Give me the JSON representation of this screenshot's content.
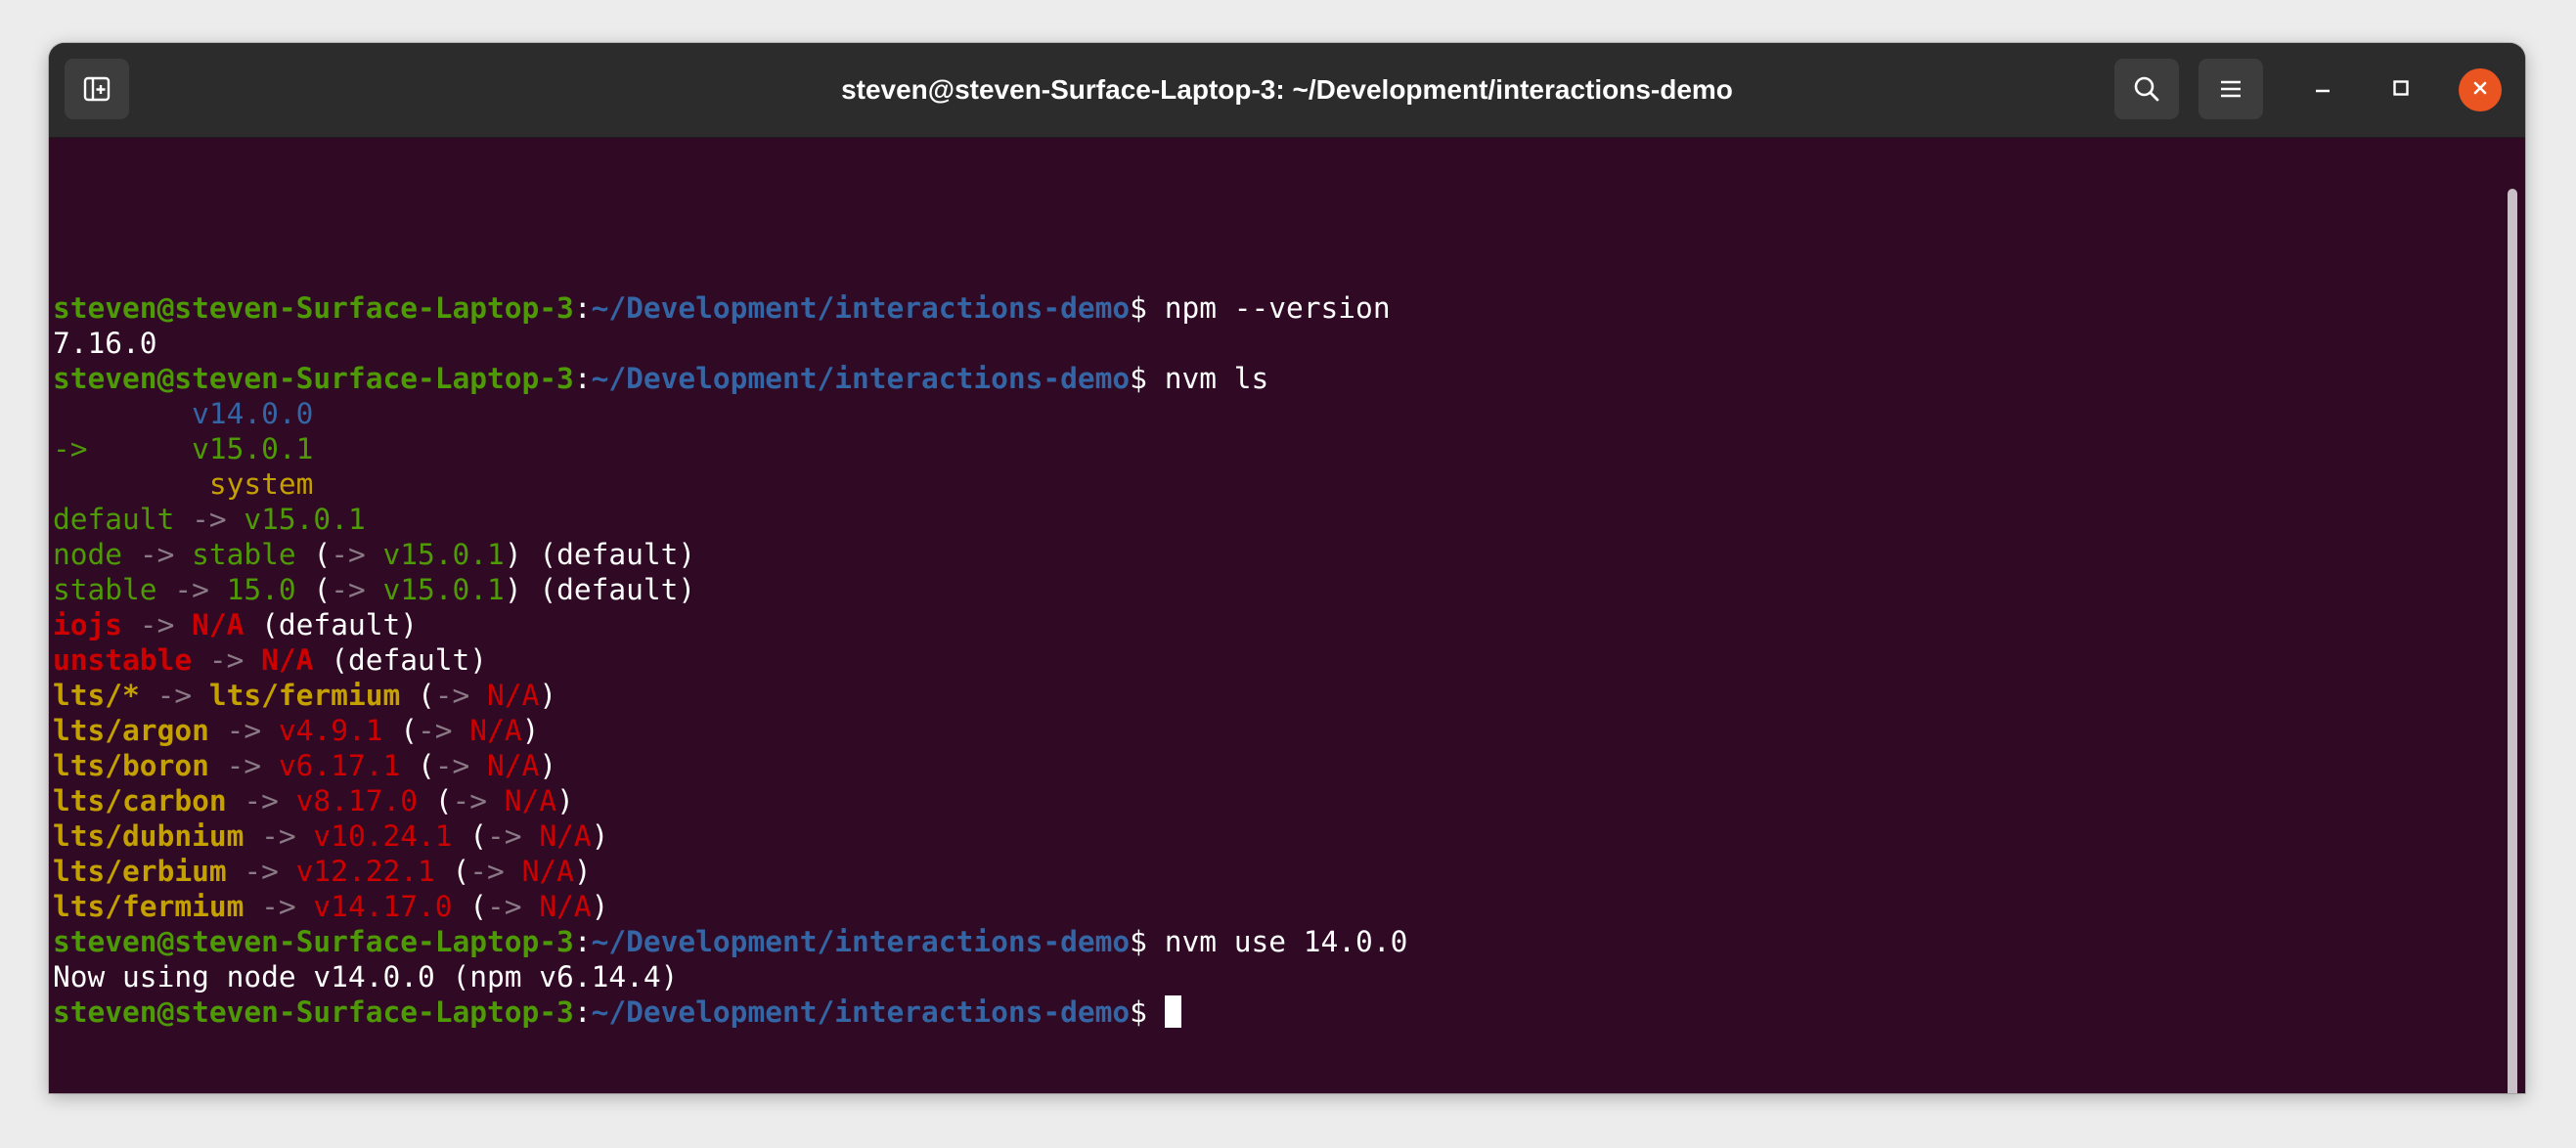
{
  "window": {
    "title": "steven@steven-Surface-Laptop-3: ~/Development/interactions-demo"
  },
  "colors": {
    "terminal_bg": "#300a24",
    "titlebar_bg": "#2c2c2c",
    "prompt_user": "#4e9a06",
    "prompt_path": "#3465a4",
    "yellow": "#c4a000",
    "red": "#cc0000",
    "close_button": "#e95420"
  },
  "icons": {
    "new_tab": "new-tab-icon",
    "search": "search-icon",
    "menu": "hamburger-menu-icon",
    "minimize": "minimize-icon",
    "maximize": "maximize-icon",
    "close": "close-icon"
  },
  "prompt": {
    "user": "steven@steven-Surface-Laptop-3",
    "colon": ":",
    "path": "~/Development/interactions-demo",
    "dollar": "$ "
  },
  "terminal": {
    "lines": [
      [
        {
          "t": "steven@steven-Surface-Laptop-3",
          "c": "pu"
        },
        {
          "t": ":",
          "c": "c-white"
        },
        {
          "t": "~/Development/interactions-demo",
          "c": "pp"
        },
        {
          "t": "$ npm --version",
          "c": "c-white"
        }
      ],
      [
        {
          "t": "7.16.0",
          "c": "c-white"
        }
      ],
      [
        {
          "t": "steven@steven-Surface-Laptop-3",
          "c": "pu"
        },
        {
          "t": ":",
          "c": "c-white"
        },
        {
          "t": "~/Development/interactions-demo",
          "c": "pp"
        },
        {
          "t": "$ nvm ls",
          "c": "c-white"
        }
      ],
      [
        {
          "t": "        v14.0.0",
          "c": "c-blue"
        }
      ],
      [
        {
          "t": "->      v15.0.1",
          "c": "c-green"
        }
      ],
      [
        {
          "t": "         system",
          "c": "c-yel"
        }
      ],
      [
        {
          "t": "default ",
          "c": "c-green"
        },
        {
          "t": "->",
          "c": "c-gray"
        },
        {
          "t": " v15.0.1",
          "c": "c-green"
        }
      ],
      [
        {
          "t": "node ",
          "c": "c-green"
        },
        {
          "t": "->",
          "c": "c-gray"
        },
        {
          "t": " stable ",
          "c": "c-green"
        },
        {
          "t": "(",
          "c": "c-white"
        },
        {
          "t": "->",
          "c": "c-gray"
        },
        {
          "t": " v15.0.1",
          "c": "c-green"
        },
        {
          "t": ") (default)",
          "c": "c-white"
        }
      ],
      [
        {
          "t": "stable ",
          "c": "c-green"
        },
        {
          "t": "->",
          "c": "c-gray"
        },
        {
          "t": " 15.0 ",
          "c": "c-green"
        },
        {
          "t": "(",
          "c": "c-white"
        },
        {
          "t": "->",
          "c": "c-gray"
        },
        {
          "t": " v15.0.1",
          "c": "c-green"
        },
        {
          "t": ") (default)",
          "c": "c-white"
        }
      ],
      [
        {
          "t": "iojs",
          "c": "c-redb"
        },
        {
          "t": " -> ",
          "c": "c-gray"
        },
        {
          "t": "N/A",
          "c": "c-redb"
        },
        {
          "t": " (default)",
          "c": "c-white"
        }
      ],
      [
        {
          "t": "unstable",
          "c": "c-redb"
        },
        {
          "t": " -> ",
          "c": "c-gray"
        },
        {
          "t": "N/A",
          "c": "c-redb"
        },
        {
          "t": " (default)",
          "c": "c-white"
        }
      ],
      [
        {
          "t": "lts/*",
          "c": "c-yelb"
        },
        {
          "t": " -> ",
          "c": "c-gray"
        },
        {
          "t": "lts/fermium",
          "c": "c-yelb"
        },
        {
          "t": " (",
          "c": "c-white"
        },
        {
          "t": "->",
          "c": "c-gray"
        },
        {
          "t": " N/A",
          "c": "c-red"
        },
        {
          "t": ")",
          "c": "c-white"
        }
      ],
      [
        {
          "t": "lts/argon",
          "c": "c-yelb"
        },
        {
          "t": " -> ",
          "c": "c-gray"
        },
        {
          "t": "v4.9.1",
          "c": "c-red"
        },
        {
          "t": " (",
          "c": "c-white"
        },
        {
          "t": "->",
          "c": "c-gray"
        },
        {
          "t": " N/A",
          "c": "c-red"
        },
        {
          "t": ")",
          "c": "c-white"
        }
      ],
      [
        {
          "t": "lts/boron",
          "c": "c-yelb"
        },
        {
          "t": " -> ",
          "c": "c-gray"
        },
        {
          "t": "v6.17.1",
          "c": "c-red"
        },
        {
          "t": " (",
          "c": "c-white"
        },
        {
          "t": "->",
          "c": "c-gray"
        },
        {
          "t": " N/A",
          "c": "c-red"
        },
        {
          "t": ")",
          "c": "c-white"
        }
      ],
      [
        {
          "t": "lts/carbon",
          "c": "c-yelb"
        },
        {
          "t": " -> ",
          "c": "c-gray"
        },
        {
          "t": "v8.17.0",
          "c": "c-red"
        },
        {
          "t": " (",
          "c": "c-white"
        },
        {
          "t": "->",
          "c": "c-gray"
        },
        {
          "t": " N/A",
          "c": "c-red"
        },
        {
          "t": ")",
          "c": "c-white"
        }
      ],
      [
        {
          "t": "lts/dubnium",
          "c": "c-yelb"
        },
        {
          "t": " -> ",
          "c": "c-gray"
        },
        {
          "t": "v10.24.1",
          "c": "c-red"
        },
        {
          "t": " (",
          "c": "c-white"
        },
        {
          "t": "->",
          "c": "c-gray"
        },
        {
          "t": " N/A",
          "c": "c-red"
        },
        {
          "t": ")",
          "c": "c-white"
        }
      ],
      [
        {
          "t": "lts/erbium",
          "c": "c-yelb"
        },
        {
          "t": " -> ",
          "c": "c-gray"
        },
        {
          "t": "v12.22.1",
          "c": "c-red"
        },
        {
          "t": " (",
          "c": "c-white"
        },
        {
          "t": "->",
          "c": "c-gray"
        },
        {
          "t": " N/A",
          "c": "c-red"
        },
        {
          "t": ")",
          "c": "c-white"
        }
      ],
      [
        {
          "t": "lts/fermium",
          "c": "c-yelb"
        },
        {
          "t": " -> ",
          "c": "c-gray"
        },
        {
          "t": "v14.17.0",
          "c": "c-red"
        },
        {
          "t": " (",
          "c": "c-white"
        },
        {
          "t": "->",
          "c": "c-gray"
        },
        {
          "t": " N/A",
          "c": "c-red"
        },
        {
          "t": ")",
          "c": "c-white"
        }
      ],
      [
        {
          "t": "steven@steven-Surface-Laptop-3",
          "c": "pu"
        },
        {
          "t": ":",
          "c": "c-white"
        },
        {
          "t": "~/Development/interactions-demo",
          "c": "pp"
        },
        {
          "t": "$ nvm use 14.0.0",
          "c": "c-white"
        }
      ],
      [
        {
          "t": "Now using node v14.0.0 (npm v6.14.4)",
          "c": "c-white"
        }
      ]
    ]
  }
}
